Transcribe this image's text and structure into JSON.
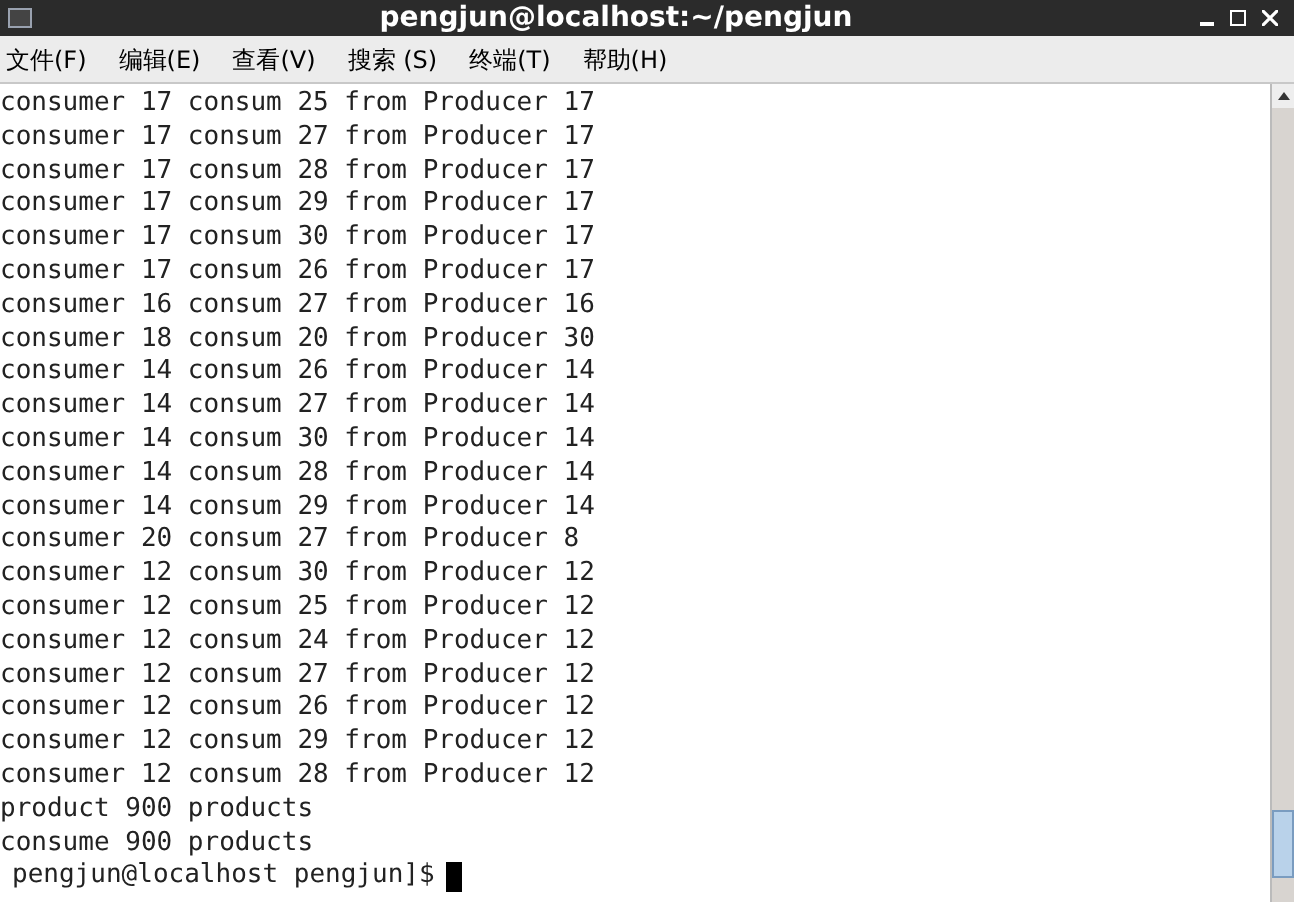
{
  "window": {
    "title": "pengjun@localhost:~/pengjun"
  },
  "menu": [
    "文件(F)",
    "编辑(E)",
    "查看(V)",
    "搜索 (S)",
    "终端(T)",
    "帮助(H)"
  ],
  "terminal": {
    "lines": [
      "consumer 17 consum 25 from Producer 17",
      "consumer 17 consum 27 from Producer 17",
      "consumer 17 consum 28 from Producer 17",
      "consumer 17 consum 29 from Producer 17",
      "consumer 17 consum 30 from Producer 17",
      "consumer 17 consum 26 from Producer 17",
      "consumer 16 consum 27 from Producer 16",
      "consumer 18 consum 20 from Producer 30",
      "consumer 14 consum 26 from Producer 14",
      "consumer 14 consum 27 from Producer 14",
      "consumer 14 consum 30 from Producer 14",
      "consumer 14 consum 28 from Producer 14",
      "consumer 14 consum 29 from Producer 14",
      "consumer 20 consum 27 from Producer 8",
      "consumer 12 consum 30 from Producer 12",
      "consumer 12 consum 25 from Producer 12",
      "consumer 12 consum 24 from Producer 12",
      "consumer 12 consum 27 from Producer 12",
      "consumer 12 consum 26 from Producer 12",
      "consumer 12 consum 29 from Producer 12",
      "consumer 12 consum 28 from Producer 12",
      "product 900 products",
      "consume 900 products"
    ],
    "prompt": "pengjun@localhost pengjun]$"
  }
}
